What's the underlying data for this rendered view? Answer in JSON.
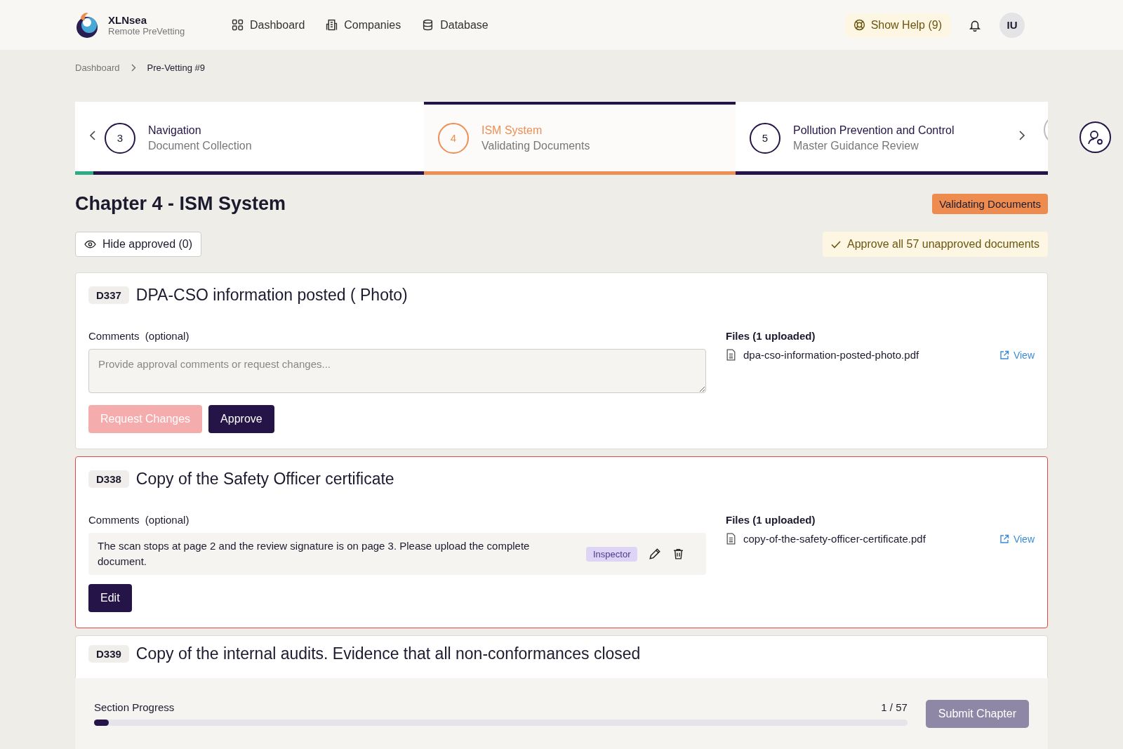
{
  "brand": {
    "name": "XLNsea",
    "subtitle": "Remote PreVetting"
  },
  "nav": [
    {
      "label": "Dashboard"
    },
    {
      "label": "Companies"
    },
    {
      "label": "Database"
    }
  ],
  "help_button": "Show Help (9)",
  "avatar": "IU",
  "breadcrumb": [
    {
      "label": "Dashboard",
      "current": false
    },
    {
      "label": "Pre-Vetting #9",
      "current": true
    }
  ],
  "steps": [
    {
      "number": "3",
      "title": "Navigation",
      "subtitle": "Document Collection",
      "selected": false
    },
    {
      "number": "4",
      "title": "ISM System",
      "subtitle": "Validating Documents",
      "selected": true
    },
    {
      "number": "5",
      "title": "Pollution Prevention and Control",
      "subtitle": "Master Guidance Review",
      "selected": false
    }
  ],
  "chapter": {
    "title": "Chapter 4 - ISM System",
    "status": "Validating Documents"
  },
  "hide_approved_button": "Hide approved (0)",
  "approve_all_button": "Approve all 57 unapproved documents",
  "documents": [
    {
      "code": "D337",
      "title": "DPA-CSO information posted ( Photo)",
      "flagged": false,
      "kind": "pending",
      "comments_label": "Comments",
      "optional_label": "(optional)",
      "placeholder": "Provide approval comments or request changes...",
      "buttons": [
        {
          "label": "Request Changes",
          "kind": "request",
          "disabled": true
        },
        {
          "label": "Approve",
          "kind": "approve",
          "disabled": false
        }
      ],
      "files_label": "Files (1 uploaded)",
      "files": [
        {
          "name": "dpa-cso-information-posted-photo.pdf",
          "action": "View"
        }
      ]
    },
    {
      "code": "D338",
      "title": "Copy of the Safety Officer certificate",
      "flagged": true,
      "kind": "commented",
      "comments_label": "Comments",
      "optional_label": "(optional)",
      "comment": {
        "text": "The scan stops at page 2 and the review signature is on page 3. Please upload the complete document.",
        "author_role": "Inspector"
      },
      "buttons": [
        {
          "label": "Edit",
          "kind": "approve",
          "disabled": false
        }
      ],
      "files_label": "Files (1 uploaded)",
      "files": [
        {
          "name": "copy-of-the-safety-officer-certificate.pdf",
          "action": "View"
        }
      ]
    },
    {
      "code": "D339",
      "title": "Copy of the internal audits. Evidence that all non-conformances closed",
      "flagged": false,
      "kind": "collapsed"
    }
  ],
  "footer": {
    "label": "Section Progress",
    "count": "1 / 57",
    "level": 0.018,
    "submit": "Submit Chapter"
  }
}
